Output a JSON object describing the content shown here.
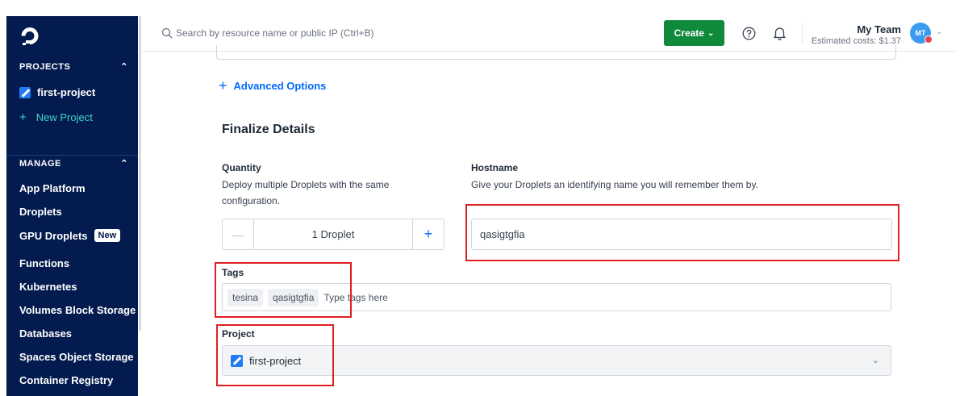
{
  "sidebar": {
    "projects_heading": "PROJECTS",
    "projects": [
      {
        "label": "first-project"
      }
    ],
    "new_project_label": "New Project",
    "manage_heading": "MANAGE",
    "items": [
      {
        "label": "App Platform"
      },
      {
        "label": "Droplets"
      },
      {
        "label": "GPU Droplets",
        "badge": "New"
      },
      {
        "label": "Functions"
      },
      {
        "label": "Kubernetes"
      },
      {
        "label": "Volumes Block Storage"
      },
      {
        "label": "Databases"
      },
      {
        "label": "Spaces Object Storage"
      },
      {
        "label": "Container Registry"
      }
    ]
  },
  "topbar": {
    "search_placeholder": "Search by resource name or public IP (Ctrl+B)",
    "create_label": "Create",
    "team_name": "My Team",
    "estimated_costs": "Estimated costs: $1.37",
    "avatar_initials": "MT"
  },
  "main": {
    "advanced_options_label": "Advanced Options",
    "section_title": "Finalize Details",
    "quantity": {
      "label": "Quantity",
      "help": "Deploy multiple Droplets with the same configuration.",
      "value": "1 Droplet",
      "decrement": "—",
      "increment": "+"
    },
    "hostname": {
      "label": "Hostname",
      "help": "Give your Droplets an identifying name you will remember them by.",
      "value": "qasigtgfia"
    },
    "tags": {
      "label": "Tags",
      "items": [
        "tesina",
        "qasigtgfia"
      ],
      "placeholder": "Type tags here"
    },
    "project": {
      "label": "Project",
      "selected": "first-project"
    }
  },
  "colors": {
    "sidebar_bg": "#031b4e",
    "accent_blue": "#0069ff",
    "create_green": "#0e8a3a",
    "highlight_red": "#e02020",
    "new_project_teal": "#3fd6c4"
  }
}
